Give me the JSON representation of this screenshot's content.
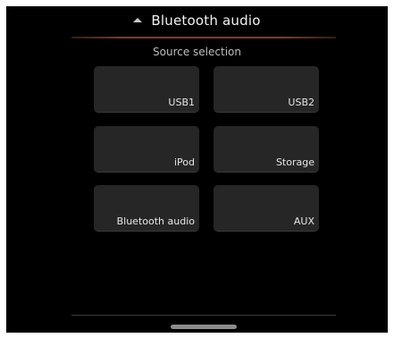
{
  "header": {
    "title": "Bluetooth audio",
    "icon": "chevron-up-icon"
  },
  "subtitle": "Source selection",
  "sources": [
    {
      "label": "USB1"
    },
    {
      "label": "USB2"
    },
    {
      "label": "iPod"
    },
    {
      "label": "Storage"
    },
    {
      "label": "Bluetooth audio"
    },
    {
      "label": "AUX"
    }
  ],
  "colors": {
    "background": "#000000",
    "tile": "#262626",
    "accent_line": "#8a3a1e"
  }
}
